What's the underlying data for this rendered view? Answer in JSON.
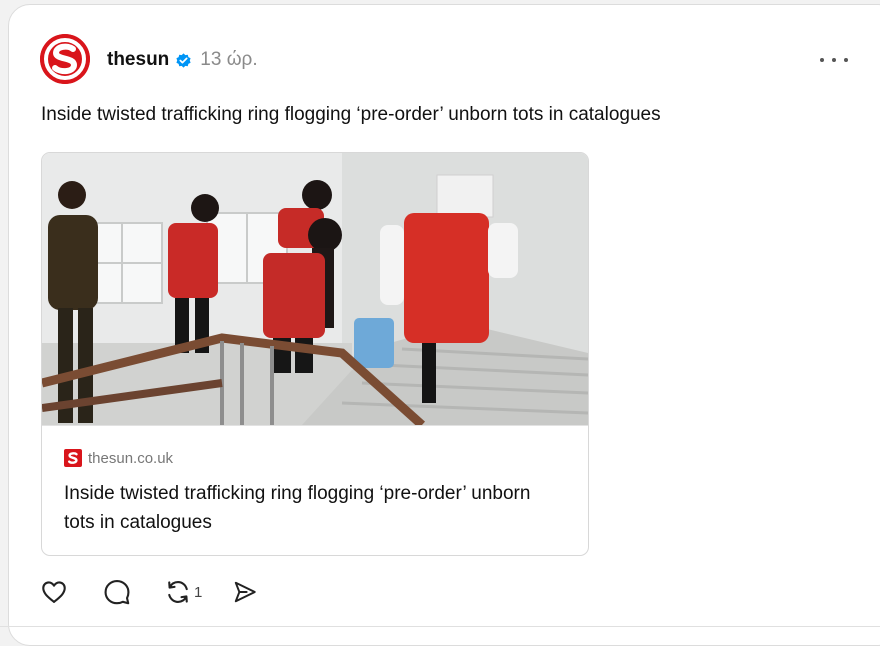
{
  "post": {
    "username": "thesun",
    "verified_icon": "verified-badge-icon",
    "timestamp": "13 ώρ.",
    "text": "Inside twisted trafficking ring flogging ‘pre-order’ unborn tots in catalogues",
    "avatar_letter": "S",
    "more_icon": "more-options-icon"
  },
  "link_preview": {
    "domain": "thesun.co.uk",
    "logo_letter": "S",
    "title": "Inside twisted trafficking ring flogging ‘pre-order’ unborn tots in catalogues"
  },
  "actions": {
    "like_icon": "heart-icon",
    "reply_icon": "comment-icon",
    "repost_icon": "repost-icon",
    "repost_count": "1",
    "share_icon": "send-icon"
  },
  "colors": {
    "brand_red": "#d9151b",
    "verified_blue": "#0095f6",
    "muted": "#8a8a8a"
  }
}
